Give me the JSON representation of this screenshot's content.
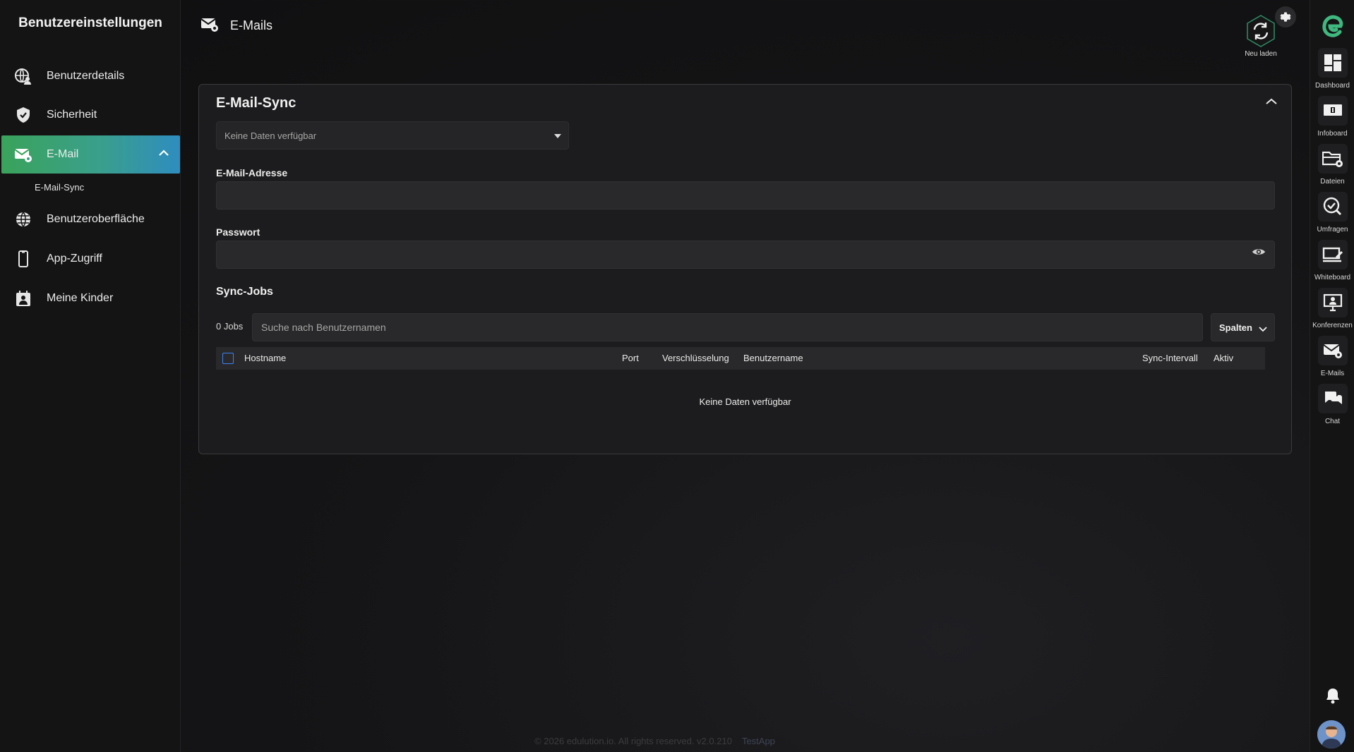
{
  "sidebar": {
    "title": "Benutzereinstellungen",
    "items": [
      {
        "label": "Benutzerdetails",
        "icon": "globe-user-icon"
      },
      {
        "label": "Sicherheit",
        "icon": "shield-check-icon"
      },
      {
        "label": "E-Mail",
        "icon": "mail-gear-icon",
        "active": true
      },
      {
        "label": "Benutzeroberfläche",
        "icon": "globe-icon"
      },
      {
        "label": "App-Zugriff",
        "icon": "mobile-icon"
      },
      {
        "label": "Meine Kinder",
        "icon": "child-calendar-icon"
      }
    ],
    "subitem": "E-Mail-Sync",
    "active_gradient": [
      "#3aa35a",
      "#3a9f8c",
      "#2f8dbf"
    ]
  },
  "header": {
    "title": "E-Mails",
    "reload_label": "Neu laden"
  },
  "card": {
    "title": "E-Mail-Sync",
    "select_placeholder": "Keine Daten verfügbar",
    "email_label": "E-Mail-Adresse",
    "email_value": "",
    "password_label": "Passwort",
    "password_value": "",
    "sync_jobs_title": "Sync-Jobs",
    "jobs_count": "0 Jobs",
    "search_placeholder": "Suche nach Benutzernamen",
    "columns_button": "Spalten",
    "table_headers": {
      "hostname": "Hostname",
      "port": "Port",
      "encryption": "Verschlüsselung",
      "username": "Benutzername",
      "interval": "Sync-Intervall",
      "active": "Aktiv"
    },
    "empty_text": "Keine Daten verfügbar"
  },
  "rail": {
    "items": [
      {
        "label": "Dashboard",
        "icon": "dashboard-icon"
      },
      {
        "label": "Infoboard",
        "icon": "infoboard-icon"
      },
      {
        "label": "Dateien",
        "icon": "folder-gear-icon"
      },
      {
        "label": "Umfragen",
        "icon": "survey-icon"
      },
      {
        "label": "Whiteboard",
        "icon": "whiteboard-icon"
      },
      {
        "label": "Konferenzen",
        "icon": "conference-icon"
      },
      {
        "label": "E-Mails",
        "icon": "mail-gear-icon"
      },
      {
        "label": "Chat",
        "icon": "chat-icon"
      }
    ],
    "brand_color": "#3fb87f"
  },
  "footer": {
    "copyright": "© 2026 edulution.io. All rights reserved. v2.0.210",
    "app_name": "TestApp"
  }
}
